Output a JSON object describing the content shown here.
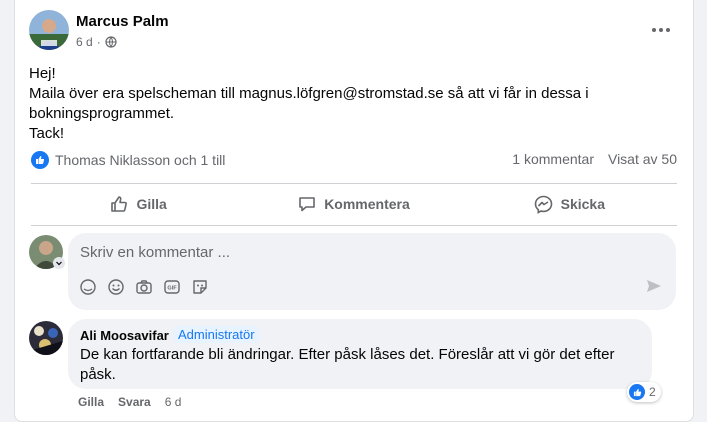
{
  "post": {
    "author": "Marcus Palm",
    "time": "6 d",
    "privacy_icon": "globe-icon",
    "body_lines": [
      "Hej!",
      "Maila över era spelscheman till magnus.löfgren@stromstad.se så att vi får in dessa i",
      "bokningsprogrammet.",
      "Tack!"
    ]
  },
  "reactions": {
    "summary": "Thomas Niklasson och 1 till",
    "comments": "1 kommentar",
    "views": "Visat av 50"
  },
  "actions": {
    "like": "Gilla",
    "comment": "Kommentera",
    "send": "Skicka"
  },
  "composer": {
    "placeholder": "Skriv en kommentar ..."
  },
  "comment": {
    "author": "Ali Moosavifar",
    "badge": "Administratör",
    "text": "De kan fortfarande bli ändringar. Efter påsk låses det. Föreslår att vi gör det efter påsk.",
    "like": "Gilla",
    "reply": "Svara",
    "time": "6 d",
    "reaction_count": "2"
  },
  "colors": {
    "accent": "#1877f2",
    "secondary_text": "#65676b",
    "bubble": "#f0f2f5"
  }
}
